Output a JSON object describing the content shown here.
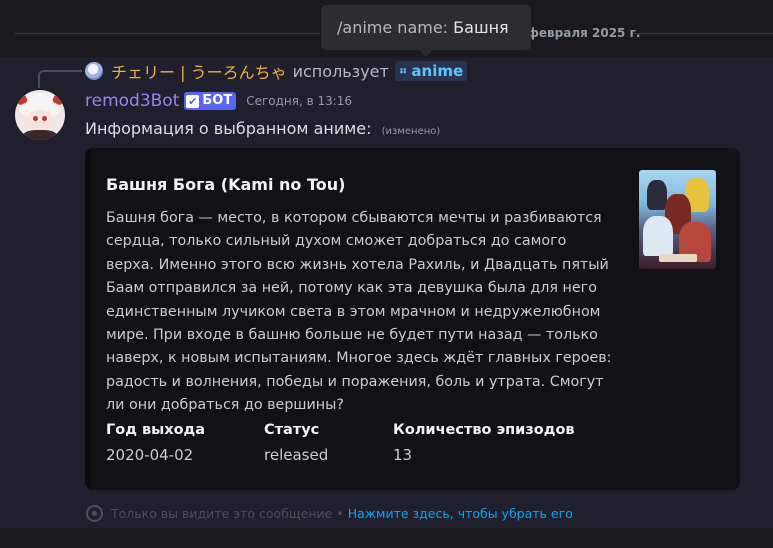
{
  "date_divider": "февраля 2025 г.",
  "tooltip": {
    "command": "/anime name:",
    "value": "Башня"
  },
  "reply": {
    "user": "チェリー | うーろんちゃ",
    "verb": "использует",
    "command": "anime"
  },
  "message": {
    "author": "remod3Bot",
    "badge": "БОТ",
    "timestamp": "Сегодня, в 13:16",
    "text": "Информация о выбранном аниме:",
    "edited": "(изменено)"
  },
  "embed": {
    "title": "Башня Бога (Kami no Tou)",
    "description": "Башня бога — место, в котором сбываются мечты и разбиваются сердца, только сильный духом сможет добраться до самого верха. Именно этого всю жизнь хотела Рахиль, и Двадцать пятый Баам отправился за ней, потому как эта девушка была для него единственным лучиком света в этом мрачном и недружелюбном мире. При входе в башню больше не будет пути назад — только наверх, к новым испытаниям. Многое здесь ждёт главных героев: радость и волнения, победы и поражения, боль и утрата. Смогут ли они добраться до вершины?",
    "fields": [
      {
        "name": "Год выхода",
        "value": "2020-04-02"
      },
      {
        "name": "Статус",
        "value": "released"
      },
      {
        "name": "Количество эпизодов",
        "value": "13"
      }
    ]
  },
  "ephemeral": {
    "text": "Только вы видите это сообщение",
    "separator": "•",
    "link": "Нажмите здесь, чтобы убрать его"
  },
  "colors": {
    "bot_name": "#9b84ec",
    "bot_badge": "#5865f2",
    "reply_name": "#f0b232",
    "command_chip": "#5cc8ff",
    "link": "#00a8fc"
  },
  "icons": [
    "reply-avatar",
    "bot-avatar",
    "check-icon",
    "command-icon",
    "eye-icon",
    "embed-thumbnail"
  ]
}
